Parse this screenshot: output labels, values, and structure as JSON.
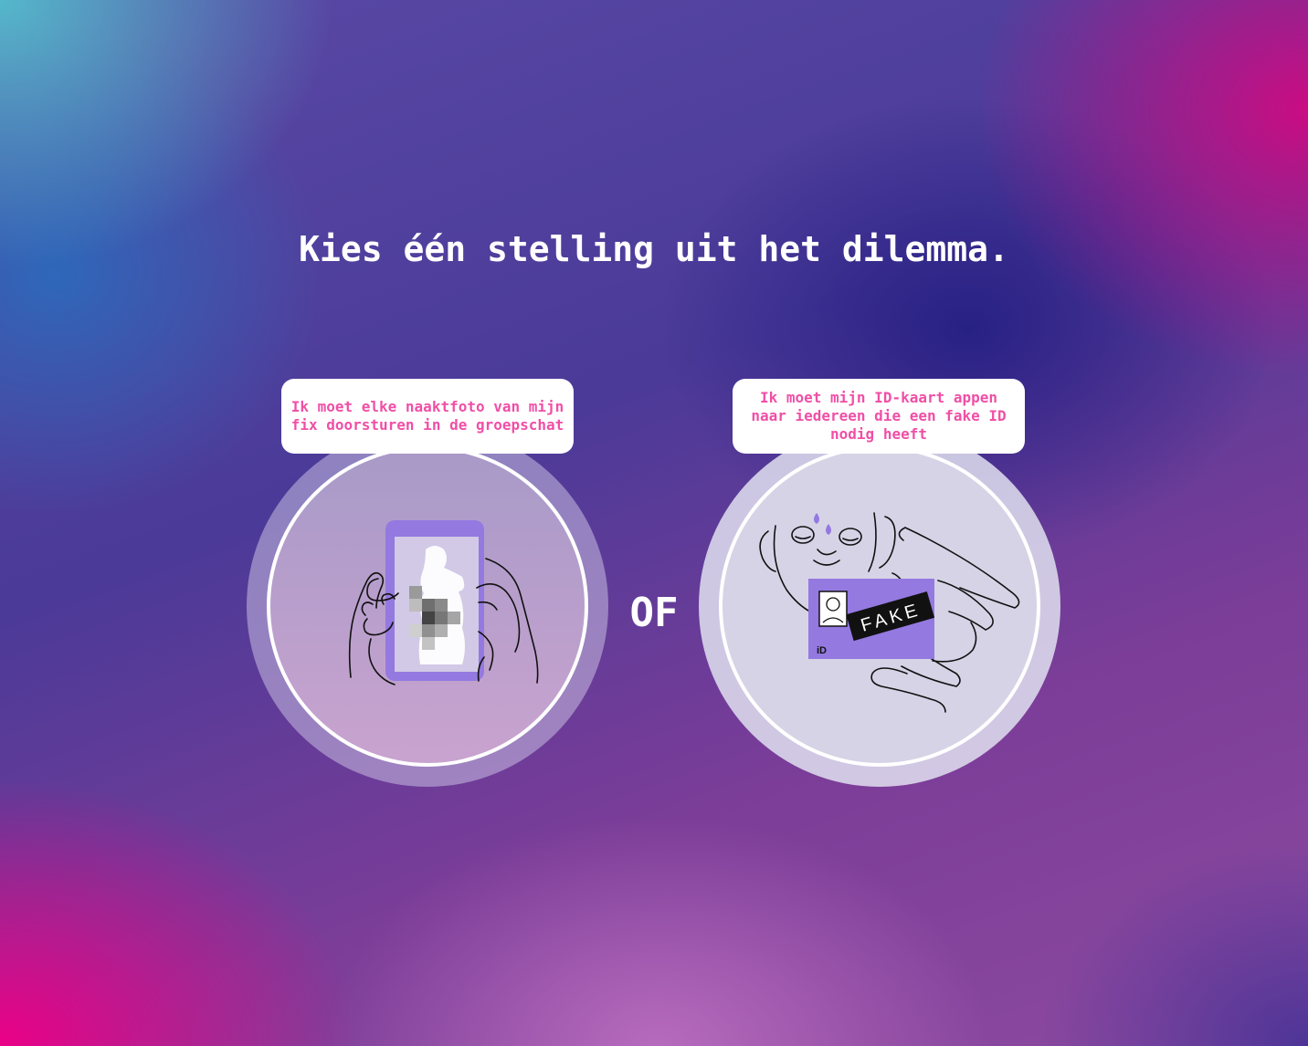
{
  "heading": "Kies één stelling uit het dilemma.",
  "options": [
    {
      "label": "Ik moet elke naaktfoto van mijn fix doorsturen in de groepschat",
      "icon": "phone-blurred-photo-icon"
    },
    {
      "label": "Ik moet mijn ID-kaart appen naar iedereen die een fake ID nodig heeft",
      "icon": "fake-id-card-icon",
      "card_stamp": "FAKE",
      "card_label": "iD"
    }
  ],
  "separator": "OF",
  "colors": {
    "bubble_text": "#f04fa6",
    "accent_purple": "#9479e0",
    "white": "#ffffff"
  }
}
